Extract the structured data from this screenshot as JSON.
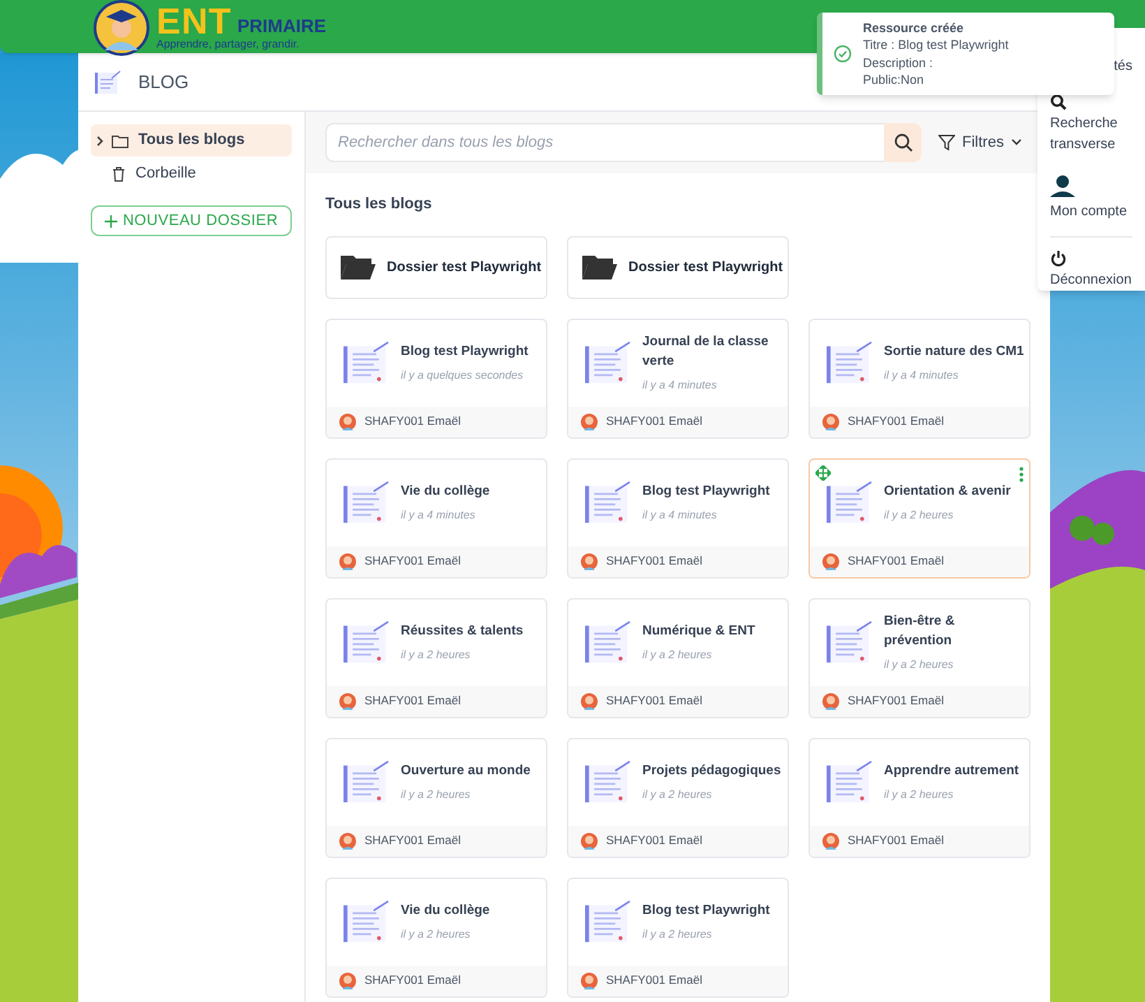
{
  "brand": {
    "name_part_1": "ENT",
    "name_part_2": "PRIMAIRE",
    "tagline": "Apprendre, partager, grandir."
  },
  "app": {
    "title": "BLOG"
  },
  "sidebar": {
    "items": [
      {
        "label": "Tous les blogs",
        "kind": "folder",
        "selected": true
      },
      {
        "label": "Corbeille",
        "kind": "trash",
        "selected": false
      }
    ],
    "new_folder_button": "NOUVEAU DOSSIER"
  },
  "search": {
    "placeholder": "Rechercher dans tous les blogs"
  },
  "filters_button": "Filtres",
  "section_title": "Tous les blogs",
  "folders": [
    {
      "name": "Dossier test Playwright"
    },
    {
      "name": "Dossier test Playwright"
    }
  ],
  "blogs": [
    {
      "title": "Blog test Playwright",
      "time": "il y a quelques secondes",
      "author": "SHAFY001 Emaël",
      "selected": false
    },
    {
      "title": "Journal de la classe verte",
      "time": "il y a 4 minutes",
      "author": "SHAFY001 Emaël",
      "selected": false
    },
    {
      "title": "Sortie nature des CM1",
      "time": "il y a 4 minutes",
      "author": "SHAFY001 Emaël",
      "selected": false
    },
    {
      "title": "Vie du collège",
      "time": "il y a 4 minutes",
      "author": "SHAFY001 Emaël",
      "selected": false
    },
    {
      "title": "Blog test Playwright",
      "time": "il y a 4 minutes",
      "author": "SHAFY001 Emaël",
      "selected": false
    },
    {
      "title": "Orientation & avenir",
      "time": "il y a 2 heures",
      "author": "SHAFY001 Emaël",
      "selected": true
    },
    {
      "title": "Réussites & talents",
      "time": "il y a 2 heures",
      "author": "SHAFY001 Emaël",
      "selected": false
    },
    {
      "title": "Numérique & ENT",
      "time": "il y a 2 heures",
      "author": "SHAFY001 Emaël",
      "selected": false
    },
    {
      "title": "Bien-être & prévention",
      "time": "il y a 2 heures",
      "author": "SHAFY001 Emaël",
      "selected": false
    },
    {
      "title": "Ouverture au monde",
      "time": "il y a 2 heures",
      "author": "SHAFY001 Emaël",
      "selected": false
    },
    {
      "title": "Projets pédagogiques",
      "time": "il y a 2 heures",
      "author": "SHAFY001 Emaël",
      "selected": false
    },
    {
      "title": "Apprendre autrement",
      "time": "il y a 2 heures",
      "author": "SHAFY001 Emaël",
      "selected": false
    },
    {
      "title": "Vie du collège",
      "time": "il y a 2 heures",
      "author": "SHAFY001 Emaël",
      "selected": false
    },
    {
      "title": "Blog test Playwright",
      "time": "il y a 2 heures",
      "author": "SHAFY001 Emaël",
      "selected": false
    }
  ],
  "toast": {
    "title": "Ressource créée",
    "lines": [
      "Titre : Blog test Playwright",
      "Description :",
      "Public:Non"
    ]
  },
  "user_menu": {
    "items": [
      {
        "label": "tés",
        "kind": "none"
      },
      {
        "label": "Recherche transverse",
        "kind": "search"
      },
      {
        "label": "Mon compte",
        "kind": "account"
      },
      {
        "label": "Déconnexion",
        "kind": "power"
      }
    ]
  }
}
